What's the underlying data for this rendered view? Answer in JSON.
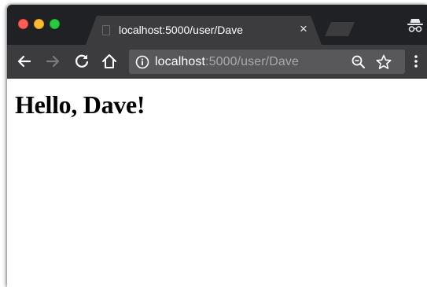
{
  "window": {
    "tab": {
      "title": "localhost:5000/user/Dave",
      "close_icon": "×"
    }
  },
  "toolbar": {
    "url_host": "localhost",
    "url_path": ":5000/user/Dave"
  },
  "page": {
    "heading": "Hello, Dave!"
  },
  "colors": {
    "tabstrip_bg": "#202124",
    "toolbar_bg": "#3c3c3e",
    "omnibox_bg": "#58585a"
  }
}
